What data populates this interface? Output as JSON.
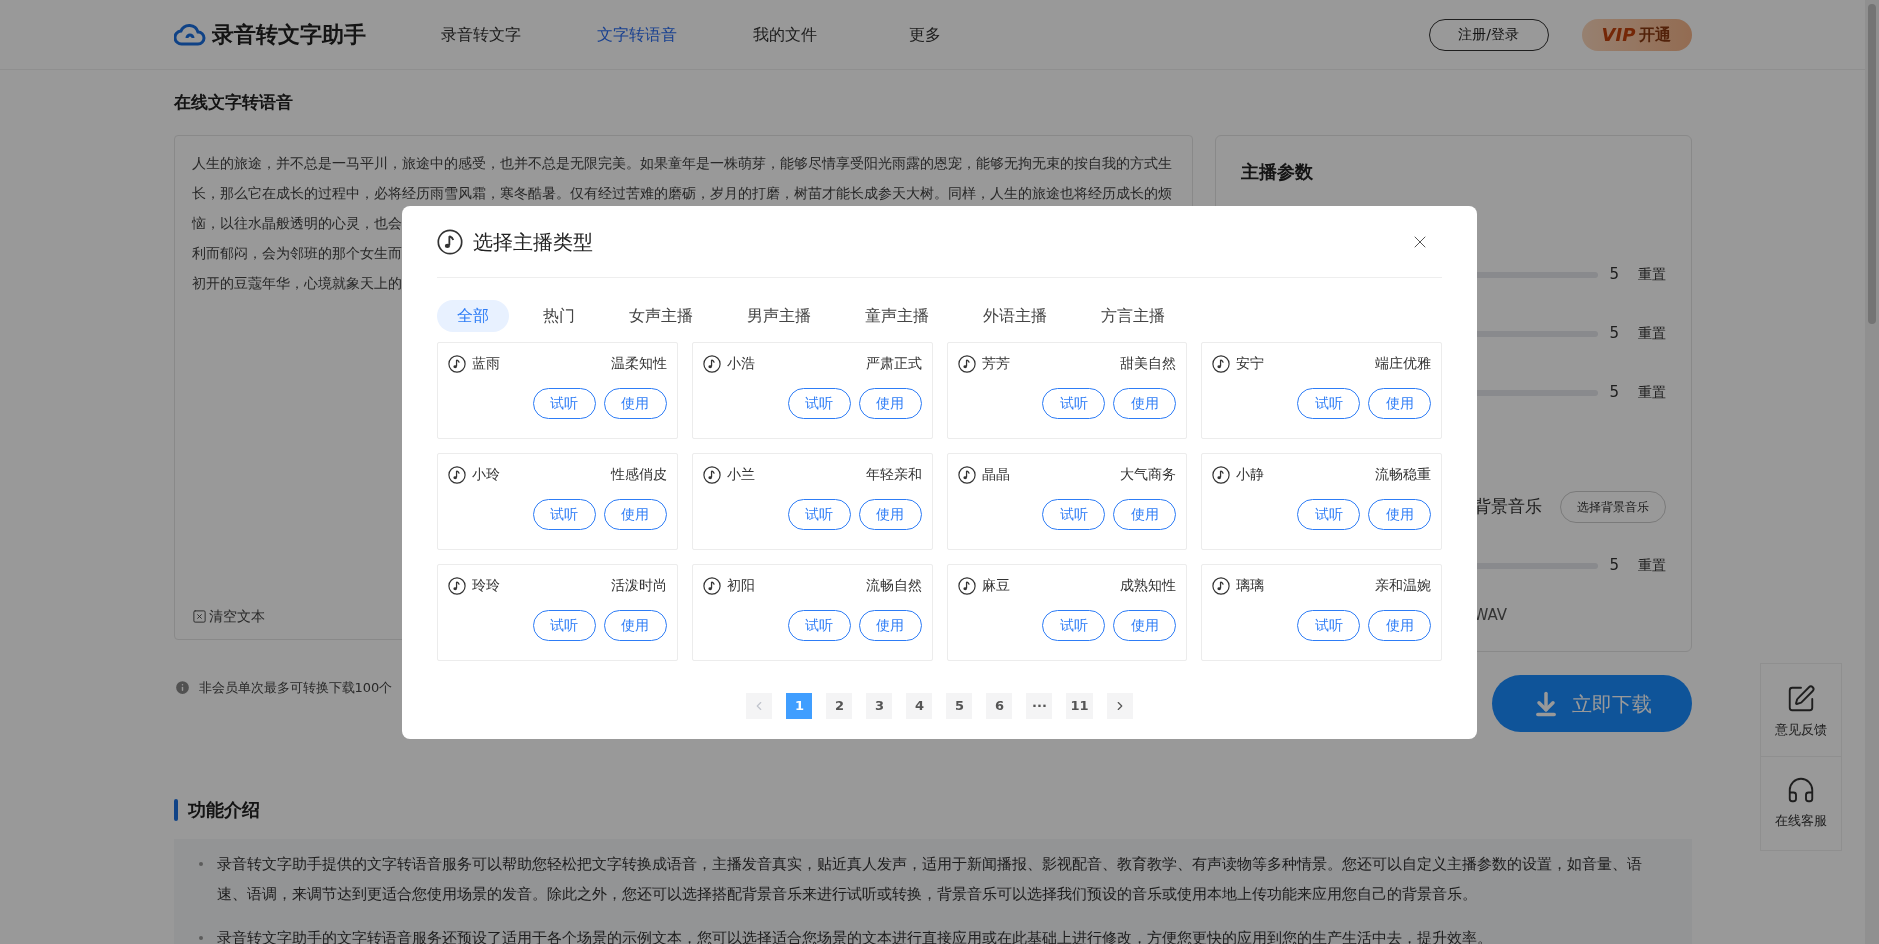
{
  "header": {
    "brand": "录音转文字助手",
    "nav": [
      {
        "label": "录音转文字",
        "selected": false
      },
      {
        "label": "文字转语音",
        "selected": true
      },
      {
        "label": "我的文件",
        "selected": false
      },
      {
        "label": "更多",
        "selected": false
      }
    ],
    "login": "注册/登录",
    "vip": {
      "badge": "VIP",
      "label": "开通"
    }
  },
  "editor": {
    "title": "在线文字转语音",
    "lines": [
      "人生的旅途，并不总是一马平川，旅途中的感受，也并不总是无限完美。如果童年是一株萌芽，能够尽情享受阳光雨露的恩宠，能够无拘无束的按自我的方式生",
      "长，那么它在成长的过程中，必将经历雨雪风霜，寒冬酷暑。仅有经过苦难的磨砺，岁月的打磨，树苗才能长成参天大树。同样，人生的旅途也将经历成长的烦",
      "恼，以往水晶般透明的心灵，也会",
      "利而郁闷，会为邻班的那个女生而",
      "初开的豆蔻年华，心境就象天上的"
    ],
    "clear": "清空文本"
  },
  "notice": "非会员单次最多可转换下载100个",
  "params": {
    "title": "主播参数",
    "rows": [
      {
        "kind": "slider",
        "value": "5",
        "reset": "重置"
      },
      {
        "kind": "slider",
        "value": "5",
        "reset": "重置"
      },
      {
        "kind": "slider",
        "value": "5",
        "reset": "重置"
      },
      {
        "kind": "music",
        "label": "背景音乐",
        "button": "选择背景音乐"
      },
      {
        "kind": "slider",
        "value": "5",
        "reset": "重置"
      },
      {
        "kind": "format",
        "label": "WAV"
      }
    ]
  },
  "download": "立即下载",
  "side": [
    {
      "kind": "feedback",
      "label": "意见反馈"
    },
    {
      "kind": "service",
      "label": "在线客服"
    }
  ],
  "intro": {
    "title": "功能介绍",
    "bullets": [
      "录音转文字助手提供的文字转语音服务可以帮助您轻松把文字转换成语音，主播发音真实，贴近真人发声，适用于新闻播报、影视配音、教育教学、有声读物等多种情景。您还可以自定义主播参数的设置，如音量、语速、语调，来调节达到更适合您使用场景的发音。除此之外，您还可以选择搭配背景音乐来进行试听或转换，背景音乐可以选择我们预设的音乐或使用本地上传功能来应用您自己的背景音乐。",
      "录音转文字助手的文字转语音服务还预设了适用于各个场景的示例文本，您可以选择适合您场景的文本进行直接应用或在此基础上进行修改，方便您更快的应用到您的生产生活中去，提升效率。"
    ]
  },
  "dialog": {
    "title": "选择主播类型",
    "tabs": [
      {
        "label": "全部",
        "selected": true
      },
      {
        "label": "热门",
        "selected": false
      },
      {
        "label": "女声主播",
        "selected": false
      },
      {
        "label": "男声主播",
        "selected": false
      },
      {
        "label": "童声主播",
        "selected": false
      },
      {
        "label": "外语主播",
        "selected": false
      },
      {
        "label": "方言主播",
        "selected": false
      }
    ],
    "voices": [
      {
        "name": "蓝雨",
        "style": "温柔知性",
        "preview": "试听",
        "use": "使用"
      },
      {
        "name": "小浩",
        "style": "严肃正式",
        "preview": "试听",
        "use": "使用"
      },
      {
        "name": "芳芳",
        "style": "甜美自然",
        "preview": "试听",
        "use": "使用"
      },
      {
        "name": "安宁",
        "style": "端庄优雅",
        "preview": "试听",
        "use": "使用"
      },
      {
        "name": "小玲",
        "style": "性感俏皮",
        "preview": "试听",
        "use": "使用"
      },
      {
        "name": "小兰",
        "style": "年轻亲和",
        "preview": "试听",
        "use": "使用"
      },
      {
        "name": "晶晶",
        "style": "大气商务",
        "preview": "试听",
        "use": "使用"
      },
      {
        "name": "小静",
        "style": "流畅稳重",
        "preview": "试听",
        "use": "使用"
      },
      {
        "name": "玲玲",
        "style": "活泼时尚",
        "preview": "试听",
        "use": "使用"
      },
      {
        "name": "初阳",
        "style": "流畅自然",
        "preview": "试听",
        "use": "使用"
      },
      {
        "name": "麻豆",
        "style": "成熟知性",
        "preview": "试听",
        "use": "使用"
      },
      {
        "name": "璃璃",
        "style": "亲和温婉",
        "preview": "试听",
        "use": "使用"
      }
    ],
    "pagination": {
      "prev": {
        "disabled": true
      },
      "next": {
        "disabled": false
      },
      "pages": [
        {
          "label": "1",
          "selected": true
        },
        {
          "label": "2",
          "selected": false
        },
        {
          "label": "3",
          "selected": false
        },
        {
          "label": "4",
          "selected": false
        },
        {
          "label": "5",
          "selected": false
        },
        {
          "label": "6",
          "selected": false
        },
        {
          "label": "···",
          "selected": false
        },
        {
          "label": "11",
          "selected": false
        }
      ]
    }
  }
}
